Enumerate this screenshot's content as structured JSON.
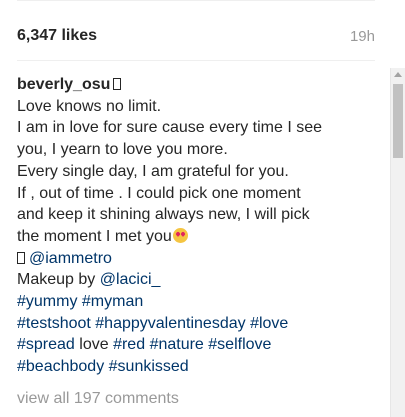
{
  "post": {
    "likes": "6,347 likes",
    "time": "19h"
  },
  "caption": {
    "username": "beverly_osu",
    "username_glyph": "box-glyph-icon",
    "lines": [
      "Love knows no limit.",
      "I am in love for sure cause every time I see",
      "you, I yearn to love you more.",
      "Every single day, I am grateful for you.",
      "If , out of time . I could pick one moment",
      "and keep it shining always new, I will pick",
      "the moment I met you"
    ],
    "emoji": "heart-eyes-emoji-icon",
    "mention_line": {
      "prefix_glyph": "box-glyph-icon",
      "mention": "@iammetro"
    },
    "makeup_line": {
      "text": "Makeup by ",
      "mention": "@lacici_"
    },
    "hashtags": {
      "yummy": "#yummy",
      "myman": "#myman",
      "testshoot": "#testshoot",
      "happyvalentinesday": "#happyvalentinesday",
      "love": "#love",
      "spread": "#spread",
      "love_word": " love ",
      "red": "#red",
      "nature": "#nature",
      "selflove": "#selflove",
      "beachbody": "#beachbody",
      "sunkissed": "#sunkissed"
    }
  },
  "comments": {
    "view_all": "view all 197 comments"
  },
  "colors": {
    "text": "#262626",
    "link": "#003569",
    "muted": "#999999"
  }
}
